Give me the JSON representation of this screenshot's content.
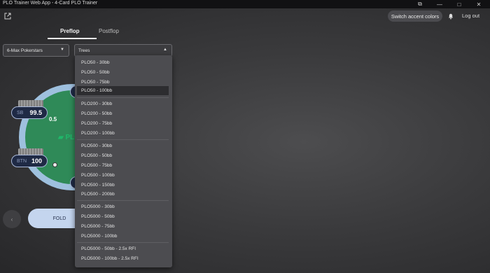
{
  "window": {
    "title": "PLO Trainer Web App - 4-Card PLO Trainer",
    "controls": [
      "⧉",
      "—",
      "□",
      "✕"
    ]
  },
  "header": {
    "accent_button": "Switch accent colors",
    "logout": "Log out"
  },
  "tabs": [
    {
      "label": "Preflop",
      "active": true
    },
    {
      "label": "Postflop",
      "active": false
    }
  ],
  "site_select": {
    "value": "6-Max Pokerstars"
  },
  "tree_select": {
    "value": "Trees"
  },
  "table": {
    "logo": "PLO",
    "seats": [
      {
        "position": "SB",
        "stack": "99.5"
      },
      {
        "position": "BTN",
        "stack": "100"
      }
    ],
    "bet": "0.5"
  },
  "actions": {
    "fold": "FOLD"
  },
  "dropdown": {
    "items": [
      "PLO50 - 30bb",
      "PLO50 - 50bb",
      "PLO50 - 75bb",
      "PLO50 - 100bb",
      "PLO200 - 30bb",
      "PLO200 - 50bb",
      "PLO200 - 75bb",
      "PLO200 - 100bb",
      "PLO500 - 30bb",
      "PLO500 - 50bb",
      "PLO500 - 75bb",
      "PLO500 - 100bb",
      "PLO500 - 150bb",
      "PLO500 - 200bb",
      "PLO5000 - 30bb",
      "PLO5000 - 50bb",
      "PLO5000 - 75bb",
      "PLO5000 - 100bb",
      "PLO5000 - 50bb - 2.5x RFI",
      "PLO5000 - 100bb - 2.5x RFI"
    ],
    "selected": "PLO50 - 100bb"
  },
  "colors": {
    "table_felt": "#2f8a58",
    "table_rail": "#9ec0de",
    "seat_bg": "#1f2a45",
    "fold_button": "#c4d5ee",
    "dropdown_bg": "#4c4c50"
  }
}
